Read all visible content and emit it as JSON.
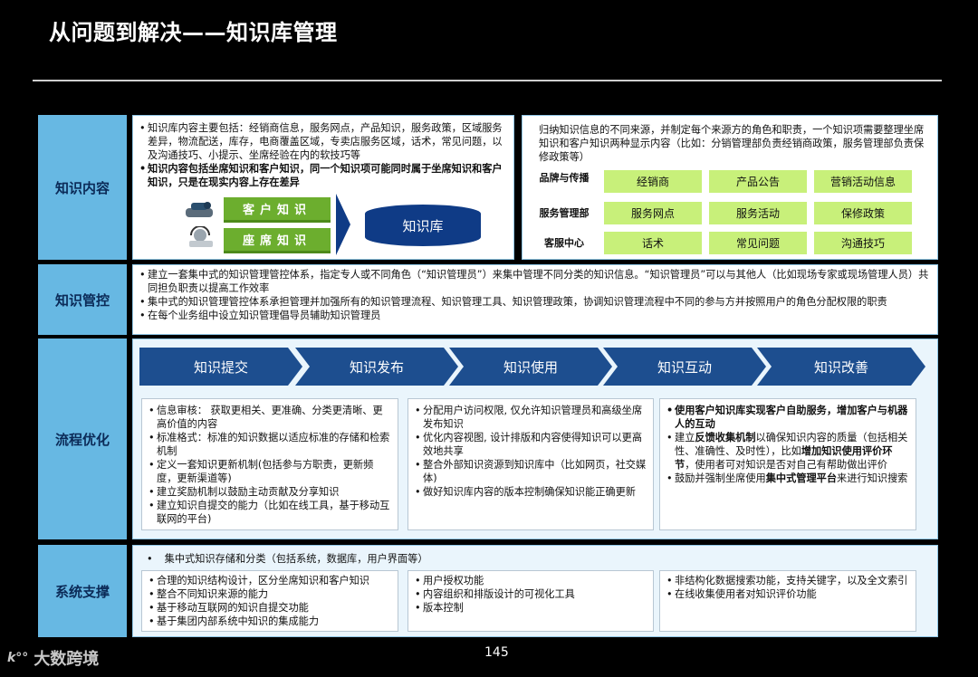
{
  "title": "从问题到解决——知识库管理",
  "page_number": "145",
  "logo": {
    "mark": "k°°",
    "text": "大数跨境"
  },
  "sections": {
    "content": {
      "label": "知识内容"
    },
    "control": {
      "label": "知识管控"
    },
    "process": {
      "label": "流程优化"
    },
    "system": {
      "label": "系统支撑"
    }
  },
  "content_left": {
    "bullets": [
      "知识库内容主要包括：经销商信息，服务网点，产品知识，服务政策，区域服务差异，物流配送，库存，电商覆盖区域，专卖店服务区域，话术，常见问题，以及沟通技巧、小提示、坐席经验在内的软技巧等",
      "知识内容包括坐席知识和客户知识，同一个知识项可能同时属于坐席知识和客户知识，只是在现实内容上存在差异"
    ],
    "customer_knowledge": "客户知识",
    "agent_knowledge": "座席知识",
    "knowledge_base": "知识库"
  },
  "content_right": {
    "intro": "归纳知识信息的不同来源，并制定每个来源方的角色和职责，一个知识项需要整理坐席知识和客户知识两种显示内容（比如：分销管理部负责经销商政策，服务管理部负责保修政策等）",
    "rows": [
      {
        "source": "品牌与传播",
        "cells": [
          "经销商",
          "产品公告",
          "营销活动信息"
        ]
      },
      {
        "source": "服务管理部",
        "cells": [
          "服务网点",
          "服务活动",
          "保修政策"
        ]
      },
      {
        "source": "客服中心",
        "cells": [
          "话术",
          "常见问题",
          "沟通技巧"
        ]
      }
    ]
  },
  "control": {
    "bullets": [
      "建立一套集中式的知识管理管控体系，指定专人或不同角色（“知识管理员”）来集中管理不同分类的知识信息。“知识管理员”可以与其他人（比如现场专家或现场管理人员）共同担负职责以提高工作效率",
      "集中式的知识管理管控体系承担管理并加强所有的知识管理流程、知识管理工具、知识管理政策，协调知识管理流程中不同的参与方并按照用户的角色分配权限的职责",
      "在每个业务组中设立知识管理倡导员辅助知识管理员"
    ]
  },
  "process": {
    "steps": [
      "知识提交",
      "知识发布",
      "知识使用",
      "知识互动",
      "知识改善"
    ],
    "box1": [
      "信息审核： 获取更相关、更准确、分类更清晰、更高价值的内容",
      "标准格式：标准的知识数据以适应标准的存储和检索机制",
      "定义一套知识更新机制(包括参与方职责，更新频度，更新渠道等)",
      "建立奖励机制以鼓励主动贡献及分享知识",
      "建立知识自提交的能力（比如在线工具，基于移动互联网的平台)"
    ],
    "box2": [
      "分配用户访问权限, 仅允许知识管理员和高级坐席发布知识",
      "优化内容视图, 设计排版和内容使得知识可以更高效地共享",
      "整合外部知识资源到知识库中（比如网页，社交媒体)",
      "做好知识库内容的版本控制确保知识能正确更新"
    ],
    "box3": {
      "b1": "使用客户知识库实现客户自助服务，增加客户与机器人的互动",
      "b2_pre": "建立",
      "b2_bold1": "反馈收集机制",
      "b2_mid": "以确保知识内容的质量（包括相关性、准确性、及时性），比如",
      "b2_bold2": "增加知识使用评价环节",
      "b2_post": "，使用者可对知识是否对自己有帮助做出评价",
      "b3_pre": "鼓励并强制坐席使用",
      "b3_bold": "集中式管理平台",
      "b3_post": "来进行知识搜索"
    }
  },
  "system": {
    "top": "集中式知识存储和分类（包括系统，数据库，用户界面等）",
    "box1": [
      "合理的知识结构设计，区分坐席知识和客户知识",
      "整合不同知识来源的能力",
      "基于移动互联网的知识自提交功能",
      "基于集团内部系统中知识的集成能力"
    ],
    "box2": [
      "用户授权功能",
      "内容组织和排版设计的可视化工具",
      "版本控制"
    ],
    "box3": [
      "非结构化数据搜索功能，支持关键字，以及全文索引",
      "在线收集使用者对知识评价功能"
    ]
  }
}
